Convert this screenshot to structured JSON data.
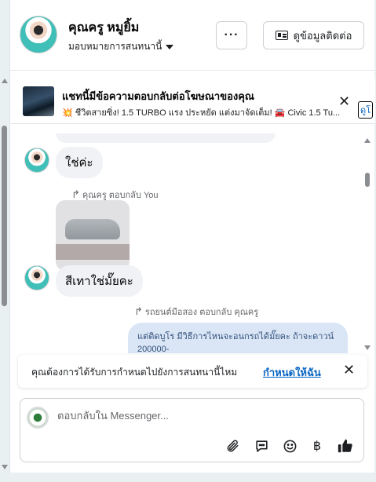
{
  "header": {
    "contact_name": "คุณครู หมูยิ้ม",
    "assign_label": "มอบหมายการสนทนานี้",
    "more_label": "···",
    "contact_info_label": "ดูข้อมูลติดต่อ"
  },
  "ad_banner": {
    "title": "แชทนี้มีข้อความตอบกลับต่อโฆษณาของคุณ",
    "subtitle": "💥 ชีวิตสายซิ่ง! 1.5 TURBO แรง ประหยัด แต่งมาจัดเต็ม! 🚘 Civic 1.5 Tu...",
    "view_label": "ดูโ",
    "close_label": "✕"
  },
  "messages": {
    "msg1": "ใช่ค่ะ",
    "reply1_meta": "คุณครู ตอบกลับ You",
    "msg2": "สีเทาใช่มั๊ยคะ",
    "reply2_meta": "รถยนต์มือสอง ตอบกลับ คุณครู",
    "outgoing_text": "แต่ติดบูโร มีวิธีการไหนจะอนกรถได้มั๊ยคะ ถ้าจะดาวน์ 200000-"
  },
  "assignment_prompt": {
    "text": "คุณต้องการได้รับการกำหนดไปยังการสนทนานี้ไหม",
    "link_label": "กำหนดให้ฉัน",
    "close_label": "✕"
  },
  "composer": {
    "placeholder": "ตอบกลับใน Messenger..."
  },
  "icons": {
    "attach": "paperclip-icon",
    "saved_replies": "chat-bubble-icon",
    "emoji": "emoji-icon",
    "payment": "baht-icon",
    "like": "thumbs-up-icon"
  },
  "colors": {
    "accent": "#0a66c2",
    "incoming_bubble": "#f0f2f5",
    "outgoing_bubble": "#d6e4f5"
  }
}
